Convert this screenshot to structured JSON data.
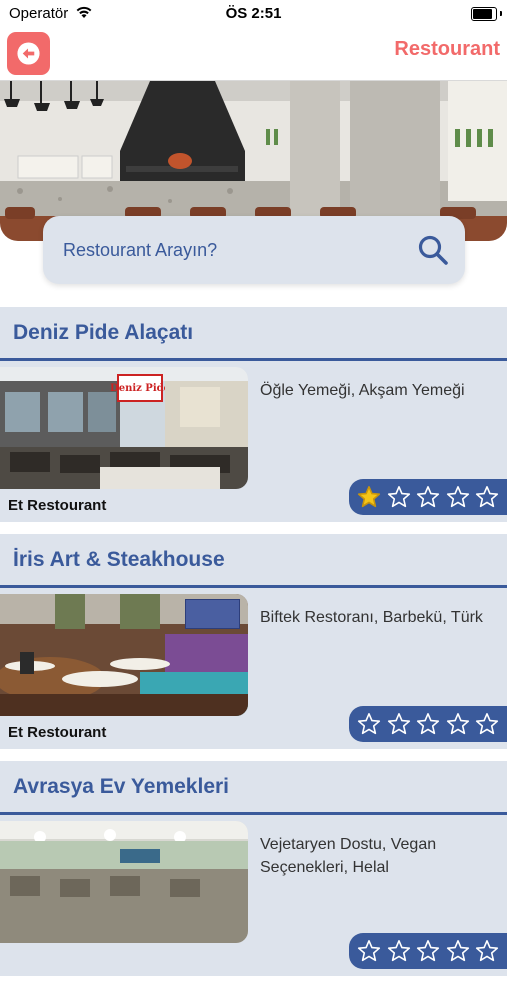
{
  "status_bar": {
    "carrier": "Operatör",
    "time": "ÖS 2:51"
  },
  "nav": {
    "title": "Restourant",
    "back_icon": "back-arrow-icon",
    "accent": "#f26a6a"
  },
  "search": {
    "placeholder": "Restourant Arayın?",
    "icon": "search-icon"
  },
  "colors": {
    "primary": "#3a5a9b",
    "card_bg": "#dde3ec",
    "star_filled": "#f5c518"
  },
  "restaurants": [
    {
      "name": "Deniz Pide Alaçatı",
      "tags": "Öğle Yemeği, Akşam Yemeği",
      "type": "Et Restourant",
      "rating": 1,
      "max_rating": 5,
      "sign_text": "Deniz Pide"
    },
    {
      "name": "İris Art & Steakhouse",
      "tags": "Biftek Restoranı, Barbekü, Türk",
      "type": "Et Restourant",
      "rating": 0,
      "max_rating": 5
    },
    {
      "name": "Avrasya Ev Yemekleri",
      "tags": "Vejetaryen Dostu, Vegan Seçenekleri, Helal",
      "type": "",
      "rating": 0,
      "max_rating": 5
    }
  ]
}
